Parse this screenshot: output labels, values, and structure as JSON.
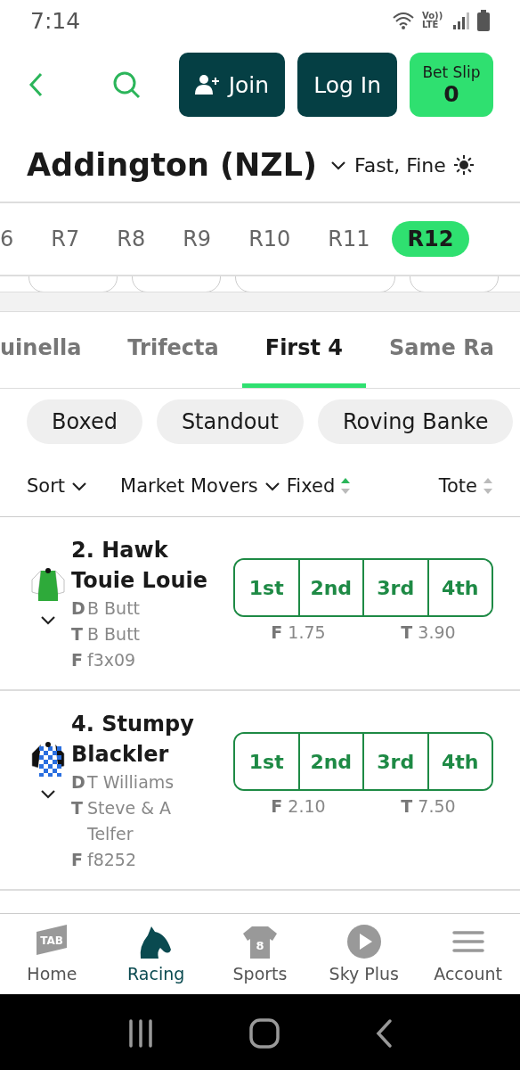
{
  "status_bar": {
    "time": "7:14",
    "network": "Vo)) LTE"
  },
  "header": {
    "join": "Join",
    "login": "Log In",
    "bet_slip": {
      "label": "Bet Slip",
      "count": "0"
    }
  },
  "venue": {
    "title": "Addington (NZL)",
    "conditions": "Fast, Fine"
  },
  "races": [
    {
      "label": "6",
      "selected": false
    },
    {
      "label": "R7",
      "selected": false
    },
    {
      "label": "R8",
      "selected": false
    },
    {
      "label": "R9",
      "selected": false
    },
    {
      "label": "R10",
      "selected": false
    },
    {
      "label": "R11",
      "selected": false
    },
    {
      "label": "R12",
      "selected": true
    }
  ],
  "bet_types": [
    {
      "label": "uinella",
      "selected": false
    },
    {
      "label": "Trifecta",
      "selected": false
    },
    {
      "label": "First 4",
      "selected": true
    },
    {
      "label": "Same Ra",
      "selected": false
    }
  ],
  "modes": [
    "Boxed",
    "Standout",
    "Roving Banke"
  ],
  "sort_bar": {
    "sort": "Sort",
    "movers": "Market Movers",
    "fixed": "Fixed",
    "tote": "Tote"
  },
  "runners": [
    {
      "name": "2. Hawk Touie Louie",
      "silk": {
        "kind": "plain"
      },
      "driver": {
        "label": "D",
        "value": "B Butt"
      },
      "trainer": {
        "label": "T",
        "value": "B Butt"
      },
      "form": {
        "label": "F",
        "value": "f3x09"
      },
      "positions": [
        "1st",
        "2nd",
        "3rd",
        "4th"
      ],
      "fixed": {
        "label": "F",
        "value": "1.75"
      },
      "tote": {
        "label": "T",
        "value": "3.90"
      }
    },
    {
      "name": "4. Stumpy Blackler",
      "silk": {
        "kind": "checked"
      },
      "driver": {
        "label": "D",
        "value": "T Williams"
      },
      "trainer": {
        "label": "T",
        "value": "Steve & A Telfer"
      },
      "form": {
        "label": "F",
        "value": "f8252"
      },
      "positions": [
        "1st",
        "2nd",
        "3rd",
        "4th"
      ],
      "fixed": {
        "label": "F",
        "value": "2.10"
      },
      "tote": {
        "label": "T",
        "value": "7.50"
      }
    }
  ],
  "nav": [
    {
      "label": "Home",
      "kind": "logo",
      "badge": "TAB",
      "selected": false
    },
    {
      "label": "Racing",
      "kind": "horse",
      "selected": true
    },
    {
      "label": "Sports",
      "kind": "shirt",
      "badge": "8",
      "selected": false
    },
    {
      "label": "Sky Plus",
      "kind": "play",
      "selected": false
    },
    {
      "label": "Account",
      "kind": "menu",
      "selected": false
    }
  ]
}
